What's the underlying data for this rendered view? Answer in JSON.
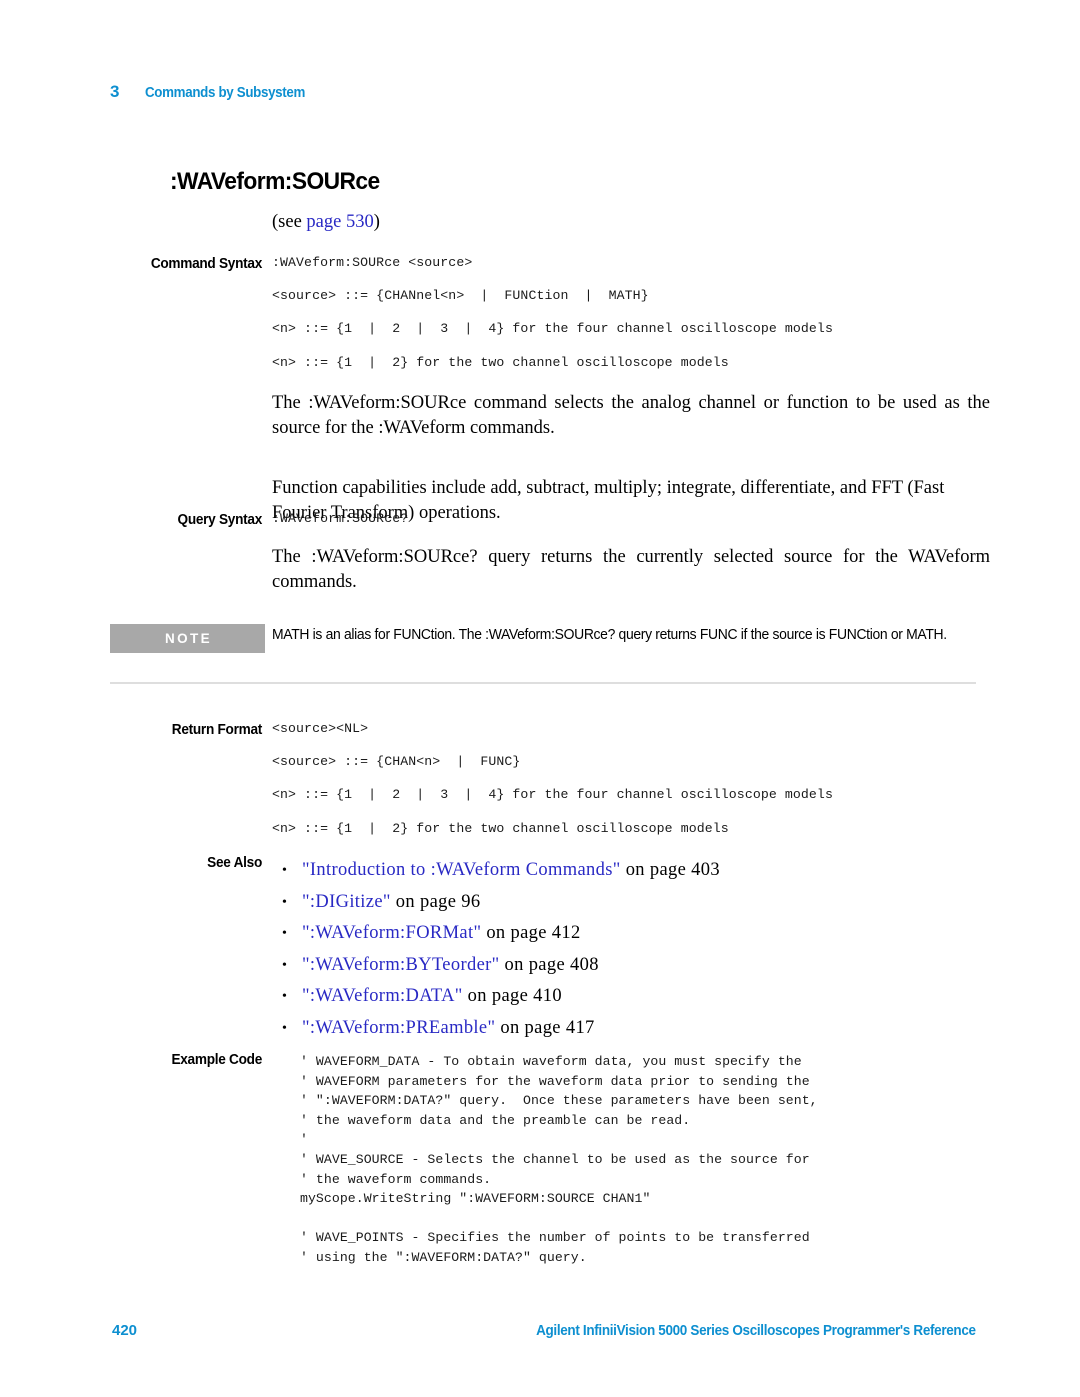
{
  "header": {
    "chapter_number": "3",
    "chapter_title": "Commands by Subsystem"
  },
  "title": ":WAVeform:SOURce",
  "see_page": {
    "prefix": "(see ",
    "link_text": "page  530",
    "suffix": ")"
  },
  "sections": {
    "command_syntax": {
      "label": "Command Syntax",
      "lines": [
        ":WAVeform:SOURce <source>",
        "<source> ::= {CHANnel<n>  |  FUNCtion  |  MATH}",
        "<n> ::= {1  |  2  |  3  |  4} for the four channel oscilloscope models",
        "<n> ::= {1  |  2} for the two channel oscilloscope models"
      ],
      "paragraphs": [
        "The :WAVeform:SOURce command selects the analog channel or function to be used as the source for the :WAVeform commands.",
        "Function capabilities include add, subtract, multiply; integrate, differentiate, and FFT (Fast Fourier Transform) operations."
      ]
    },
    "query_syntax": {
      "label": "Query Syntax",
      "lines": [
        ":WAVeform:SOURce?"
      ],
      "paragraphs": [
        "The :WAVeform:SOURce? query returns the currently selected source for the WAVeform commands."
      ]
    },
    "note": {
      "badge": "NOTE",
      "text": "MATH is an alias for FUNCtion. The :WAVeform:SOURce? query returns FUNC if the source is FUNCtion or MATH."
    },
    "return_format": {
      "label": "Return Format",
      "lines": [
        "<source><NL>",
        "<source> ::= {CHAN<n>  |  FUNC}",
        "<n> ::= {1  |  2  |  3  |  4} for the four channel oscilloscope models",
        "<n> ::= {1  |  2} for the two channel oscilloscope models"
      ]
    },
    "see_also": {
      "label": "See Also",
      "items": [
        {
          "bullet": "•",
          "link": "\"Introduction to :WAVeform Commands\"",
          "tail": " on page 403"
        },
        {
          "bullet": "•",
          "link": "\":DIGitize\"",
          "tail": " on page 96"
        },
        {
          "bullet": "•",
          "link": "\":WAVeform:FORMat\"",
          "tail": " on page 412"
        },
        {
          "bullet": "•",
          "link": "\":WAVeform:BYTeorder\"",
          "tail": " on page 408"
        },
        {
          "bullet": "•",
          "link": "\":WAVeform:DATA\"",
          "tail": " on page 410"
        },
        {
          "bullet": "•",
          "link": "\":WAVeform:PREamble\"",
          "tail": " on page 417"
        }
      ]
    },
    "example_code": {
      "label": "Example Code",
      "code": "' WAVEFORM_DATA - To obtain waveform data, you must specify the\n' WAVEFORM parameters for the waveform data prior to sending the\n' \":WAVEFORM:DATA?\" query.  Once these parameters have been sent,\n' the waveform data and the preamble can be read.\n'\n' WAVE_SOURCE - Selects the channel to be used as the source for\n' the waveform commands.\nmyScope.WriteString \":WAVEFORM:SOURCE CHAN1\"\n\n' WAVE_POINTS - Specifies the number of points to be transferred\n' using the \":WAVEFORM:DATA?\" query."
    }
  },
  "footer": {
    "page_number": "420",
    "document_title": "Agilent InfiniiVision 5000 Series Oscilloscopes Programmer's Reference"
  },
  "colors": {
    "accent_blue": "#0d8fd0",
    "link_blue": "#2929c4",
    "note_gray": "#a8a8a8",
    "divider_gray": "#dedede"
  }
}
